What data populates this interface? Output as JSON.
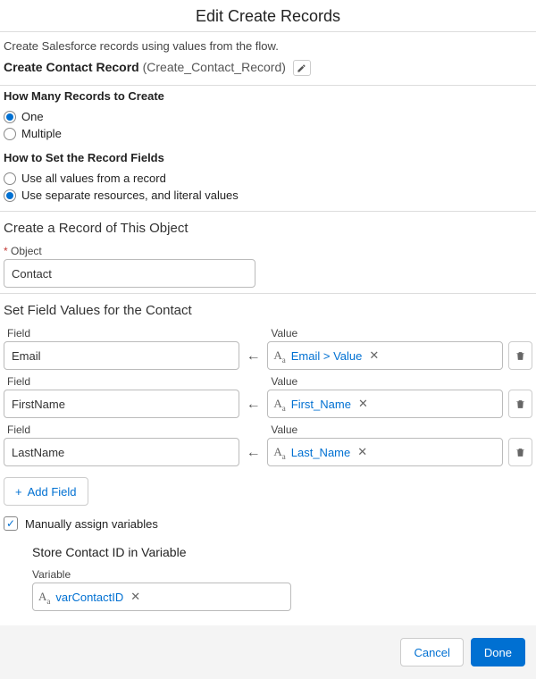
{
  "title": "Edit Create Records",
  "description": "Create Salesforce records using values from the flow.",
  "record": {
    "label": "Create Contact Record",
    "api": "(Create_Contact_Record)"
  },
  "howMany": {
    "title": "How Many Records to Create",
    "options": [
      "One",
      "Multiple"
    ],
    "selected": 0
  },
  "howSet": {
    "title": "How to Set the Record Fields",
    "options": [
      "Use all values from a record",
      "Use separate resources, and literal values"
    ],
    "selected": 1
  },
  "objectSection": {
    "title": "Create a Record of This Object",
    "fieldLabel": "Object",
    "value": "Contact"
  },
  "fieldValues": {
    "title": "Set Field Values for the Contact",
    "fieldLabel": "Field",
    "valueLabel": "Value",
    "rows": [
      {
        "field": "Email",
        "value": "Email > Value"
      },
      {
        "field": "FirstName",
        "value": "First_Name"
      },
      {
        "field": "LastName",
        "value": "Last_Name"
      }
    ],
    "addField": "Add Field"
  },
  "manualAssign": {
    "label": "Manually assign variables",
    "checked": true
  },
  "store": {
    "title": "Store Contact ID in Variable",
    "fieldLabel": "Variable",
    "value": "varContactID"
  },
  "footer": {
    "cancel": "Cancel",
    "done": "Done"
  }
}
